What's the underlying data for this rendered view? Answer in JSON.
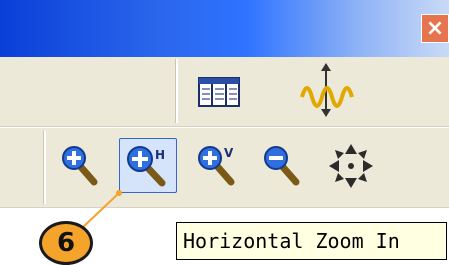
{
  "window": {
    "close_label": "×"
  },
  "toolbar_top": {
    "buttons": [
      {
        "icon": "table-view-icon",
        "tooltip": ""
      },
      {
        "icon": "signal-waveform-icon",
        "tooltip": ""
      }
    ]
  },
  "toolbar_zoom": {
    "buttons": [
      {
        "icon": "zoom-in-icon"
      },
      {
        "icon": "horizontal-zoom-in-icon",
        "pressed": true
      },
      {
        "icon": "vertical-zoom-in-icon"
      },
      {
        "icon": "zoom-out-icon"
      },
      {
        "icon": "pan-move-icon"
      }
    ],
    "h_letter": "H",
    "v_letter": "V"
  },
  "callout": {
    "number": "6",
    "color": "#f4a32b"
  },
  "tooltip": {
    "text": "Horizontal Zoom In"
  },
  "colors": {
    "titlebar": "#2f73ff",
    "close": "#e6744e",
    "toolbar": "#ece9d8",
    "tooltip_bg": "#ffffe1"
  }
}
